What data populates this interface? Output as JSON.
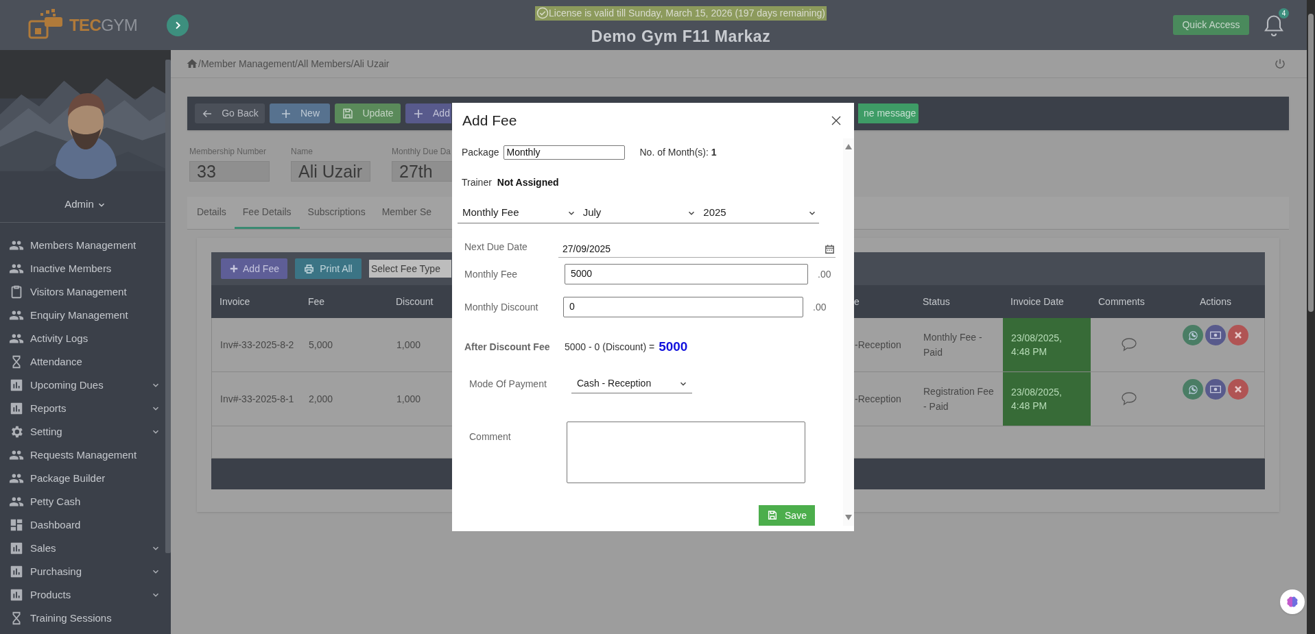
{
  "header": {
    "logo_prefix": "TEC",
    "logo_suffix": "GYM",
    "license": "License is valid till Sunday, March 15, 2026 (197 days remaining)",
    "title": "Demo Gym F11 Markaz",
    "quick_access": "Quick Access",
    "notification_count": "4"
  },
  "sidebar": {
    "user": "Admin",
    "items": [
      {
        "label": "Members Management",
        "kind": "people",
        "expandable": false
      },
      {
        "label": "Inactive Members",
        "kind": "people",
        "expandable": false
      },
      {
        "label": "Visitors Management",
        "kind": "clipboard",
        "expandable": false
      },
      {
        "label": "Enquiry Management",
        "kind": "people",
        "expandable": false
      },
      {
        "label": "Activity Logs",
        "kind": "people",
        "expandable": false
      },
      {
        "label": "Attendance",
        "kind": "hourglass",
        "expandable": false
      },
      {
        "label": "Upcoming Dues",
        "kind": "chart",
        "expandable": true
      },
      {
        "label": "Reports",
        "kind": "chart",
        "expandable": true
      },
      {
        "label": "Setting",
        "kind": "gear",
        "expandable": true
      },
      {
        "label": "Requests Management",
        "kind": "people",
        "expandable": false
      },
      {
        "label": "Package Builder",
        "kind": "people",
        "expandable": false
      },
      {
        "label": "Petty Cash",
        "kind": "people",
        "expandable": false
      },
      {
        "label": "Dashboard",
        "kind": "dashboard",
        "expandable": false
      },
      {
        "label": "Sales",
        "kind": "chart",
        "expandable": true
      },
      {
        "label": "Purchasing",
        "kind": "chart",
        "expandable": true
      },
      {
        "label": "Products",
        "kind": "chart",
        "expandable": true
      },
      {
        "label": "Training Sessions",
        "kind": "hourglass",
        "expandable": false
      }
    ]
  },
  "breadcrumb": "/Member Management/All Members/Ali Uzair",
  "toolbar": [
    {
      "label": "Go Back",
      "kind": "back"
    },
    {
      "label": "New",
      "kind": "new"
    },
    {
      "label": "Update",
      "kind": "update"
    },
    {
      "label": "Add",
      "kind": "add"
    },
    {
      "label": "ne message",
      "kind": "message"
    }
  ],
  "member_fields": [
    {
      "label": "Membership Number",
      "value": "33"
    },
    {
      "label": "Name",
      "value": "Ali Uzair"
    },
    {
      "label": "Monthly Due Da",
      "value": "27th"
    }
  ],
  "tabs": [
    {
      "label": "Details",
      "selected": false
    },
    {
      "label": "Fee Details",
      "selected": true
    },
    {
      "label": "Subscriptions",
      "selected": false
    },
    {
      "label": "Member Se",
      "selected": false
    }
  ],
  "fee_toolbar": {
    "add": "Add Fee",
    "print": "Print All",
    "fee_type_placeholder": "Select Fee Type"
  },
  "table": {
    "columns": [
      "Invoice",
      "Fee",
      "Discount",
      "e",
      "Status",
      "Invoice Date",
      "Comments",
      "Actions"
    ],
    "rows": [
      {
        "cells": [
          "Inv#-33-2025-8-2",
          "5,000",
          "1,000",
          "-Reception",
          "Monthly Fee - Paid",
          "23/08/2025, 4:48 PM"
        ],
        "highlighted": true
      },
      {
        "cells": [
          "Inv#-33-2025-8-1",
          "2,000",
          "1,000",
          "-Reception",
          "Registration Fee - Paid",
          "23/08/2025, 4:48 PM"
        ],
        "highlighted": true
      }
    ]
  },
  "modal": {
    "title": "Add Fee",
    "package_label": "Package",
    "package_value": "Monthly",
    "months_label": "No. of Month(s):",
    "months_value": "1",
    "trainer_label": "Trainer",
    "trainer_value": "Not Assigned",
    "selects": [
      "Monthly Fee",
      "July",
      "2025"
    ],
    "next_due_label": "Next Due Date",
    "next_due_value": "27/09/2025",
    "fee_label": "Monthly Fee",
    "fee_value": "5000",
    "fee_suffix": ".00",
    "discount_label": "Monthly Discount",
    "discount_value": "0",
    "discount_suffix": ".00",
    "after_label": "After Discount Fee",
    "after_formula": "5000 - 0 (Discount) =",
    "after_total": "5000",
    "payment_label": "Mode Of Payment",
    "payment_value": "Cash - Reception",
    "comment_label": "Comment",
    "save": "Save"
  }
}
